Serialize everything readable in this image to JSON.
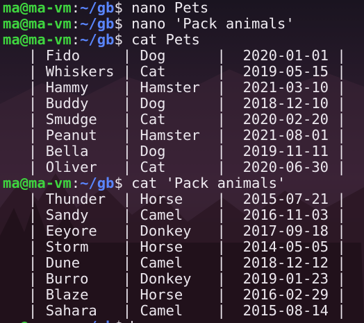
{
  "prompt": {
    "user": "ma@ma-vm",
    "colon": ":",
    "path": "~/gb",
    "dollar": "$ "
  },
  "commands": {
    "cmd1": "nano Pets",
    "cmd2": "nano 'Pack animals'",
    "cmd3": "cat Pets",
    "cmd4": "cat 'Pack animals'"
  },
  "pets_rows": [
    "   | Fido     | Dog      |  2020-01-01 |",
    "   | Whiskers | Cat      |  2019-05-15 |",
    "   | Hammy    | Hamster  |  2021-03-10 |",
    "   | Buddy    | Dog      |  2018-12-10 |",
    "   | Smudge   | Cat      |  2020-02-20 |",
    "   | Peanut   | Hamster  |  2021-08-01 |",
    "   | Bella    | Dog      |  2019-11-11 |",
    "   | Oliver   | Cat      |  2020-06-30 |"
  ],
  "pack_rows": [
    "   | Thunder  | Horse    |  2015-07-21 |",
    "   | Sandy    | Camel    |  2016-11-03 |",
    "   | Eeyore   | Donkey   |  2017-09-18 |",
    "   | Storm    | Horse    |  2014-05-05 |",
    "   | Dune     | Camel    |  2018-12-12 |",
    "   | Burro    | Donkey   |  2019-01-23 |",
    "   | Blaze    | Horse    |  2016-02-29 |",
    "   | Sahara   | Camel    |  2015-08-14 |"
  ],
  "colors": {
    "user": "#3fd53f",
    "path": "#5a86ff",
    "text": "#e9e4ea"
  }
}
